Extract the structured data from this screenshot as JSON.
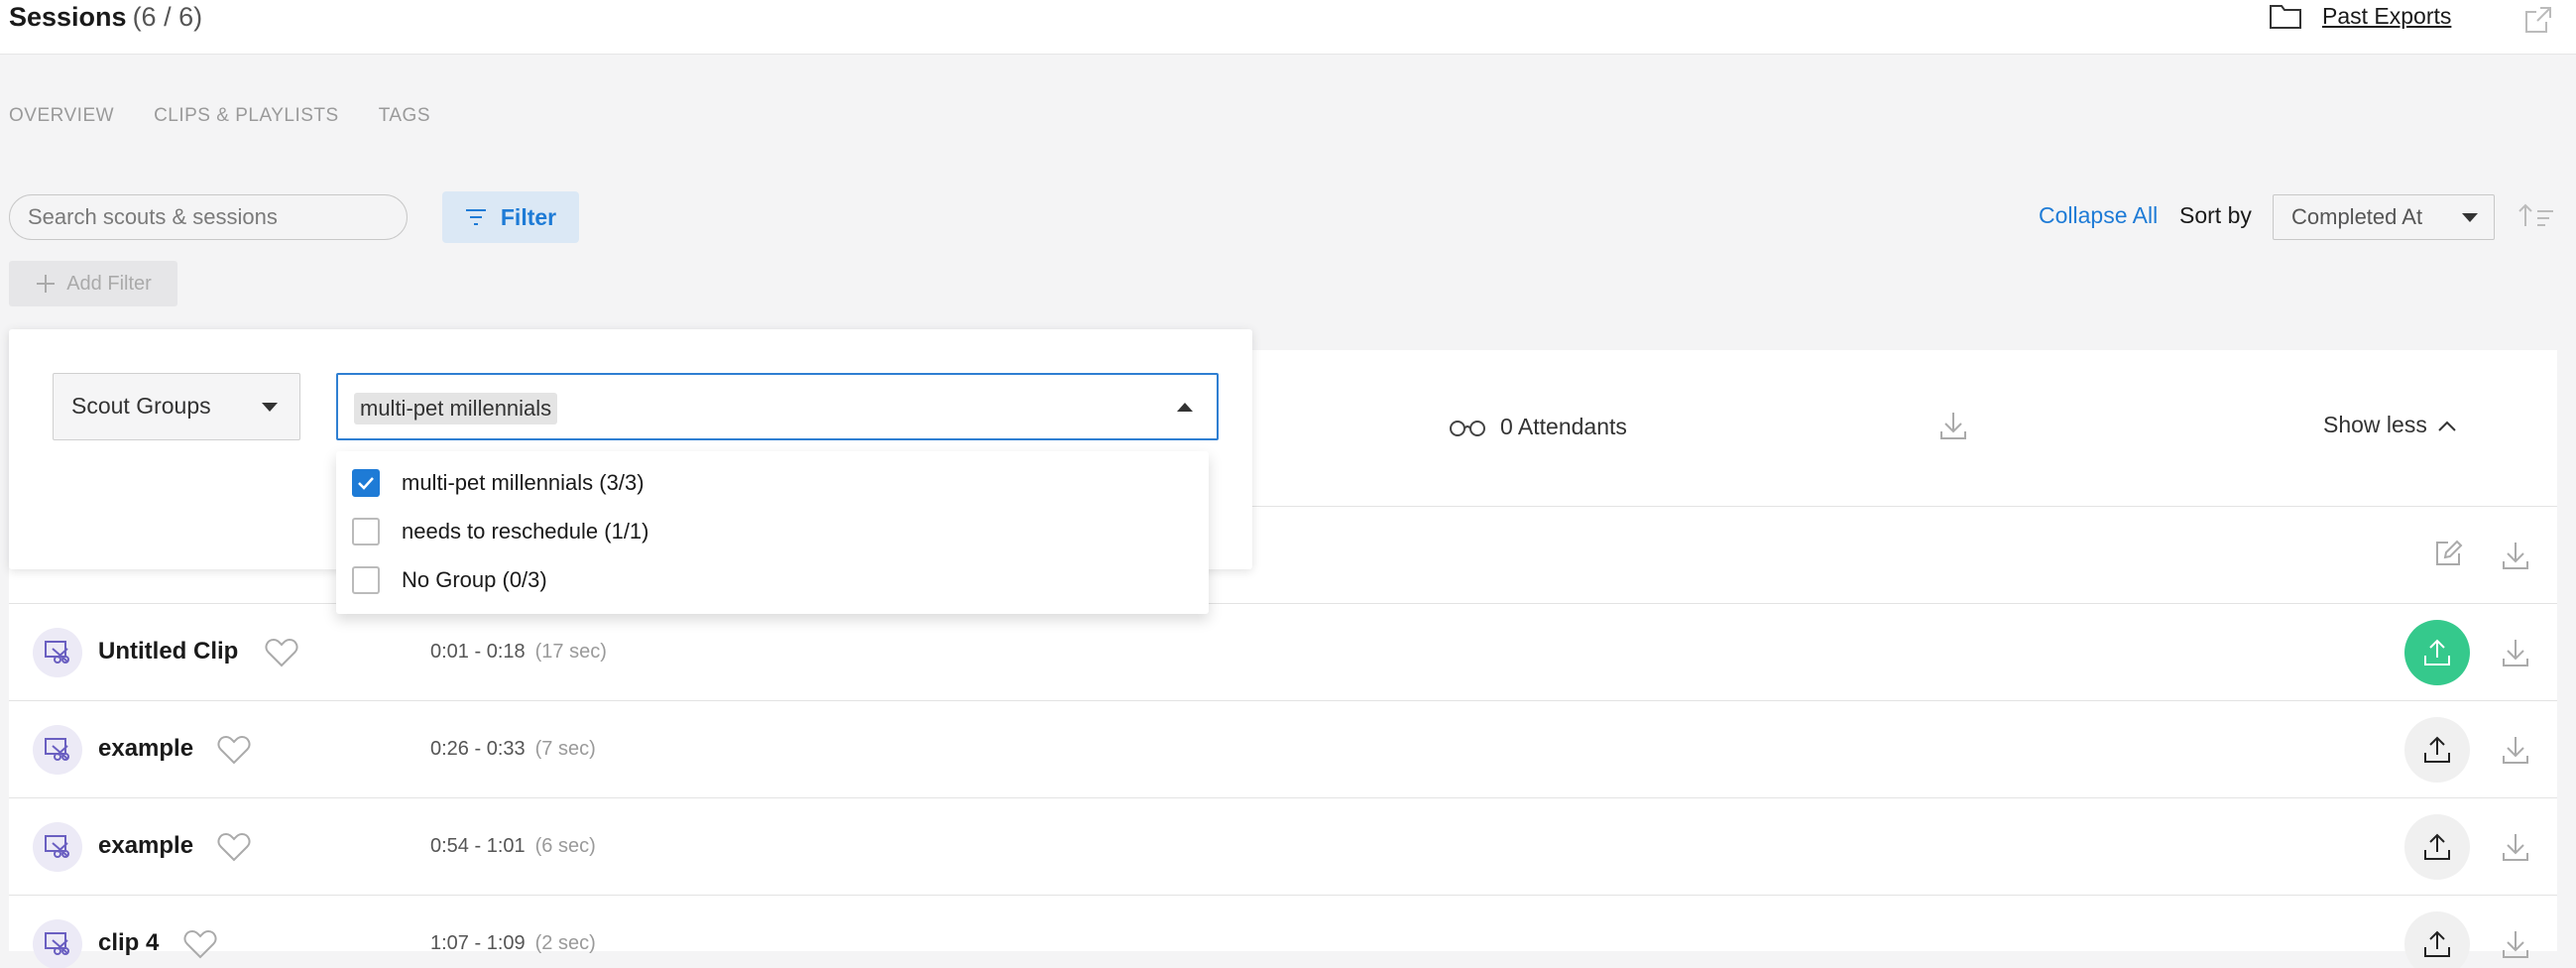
{
  "header": {
    "title": "Sessions",
    "count": "(6 / 6)",
    "past_exports": "Past Exports"
  },
  "tabs": [
    "OVERVIEW",
    "CLIPS & PLAYLISTS",
    "TAGS"
  ],
  "toolbar": {
    "search_placeholder": "Search scouts & sessions",
    "filter_label": "Filter",
    "add_filter_label": "Add Filter",
    "collapse_all": "Collapse All",
    "sort_by_label": "Sort by",
    "sort_value": "Completed At"
  },
  "session": {
    "attendants": "0 Attendants",
    "show_less": "Show less"
  },
  "clips": [
    {
      "name": "Untitled Clip",
      "range": "0:01 - 0:18",
      "duration": "(17 sec)",
      "upload_active": true
    },
    {
      "name": "example",
      "range": "0:26 - 0:33",
      "duration": "(7 sec)",
      "upload_active": false
    },
    {
      "name": "example",
      "range": "0:54 - 1:01",
      "duration": "(6 sec)",
      "upload_active": false
    },
    {
      "name": "clip 4",
      "range": "1:07 - 1:09",
      "duration": "(2 sec)",
      "upload_active": false
    }
  ],
  "filter_popover": {
    "field": "Scout Groups",
    "selected_chip": "multi-pet millennials",
    "options": [
      {
        "label": "multi-pet millennials (3/3)",
        "checked": true
      },
      {
        "label": "needs to reschedule (1/1)",
        "checked": false
      },
      {
        "label": "No Group (0/3)",
        "checked": false
      }
    ]
  },
  "colors": {
    "accent": "#1e7bd6",
    "upload_active": "#35c98c"
  }
}
